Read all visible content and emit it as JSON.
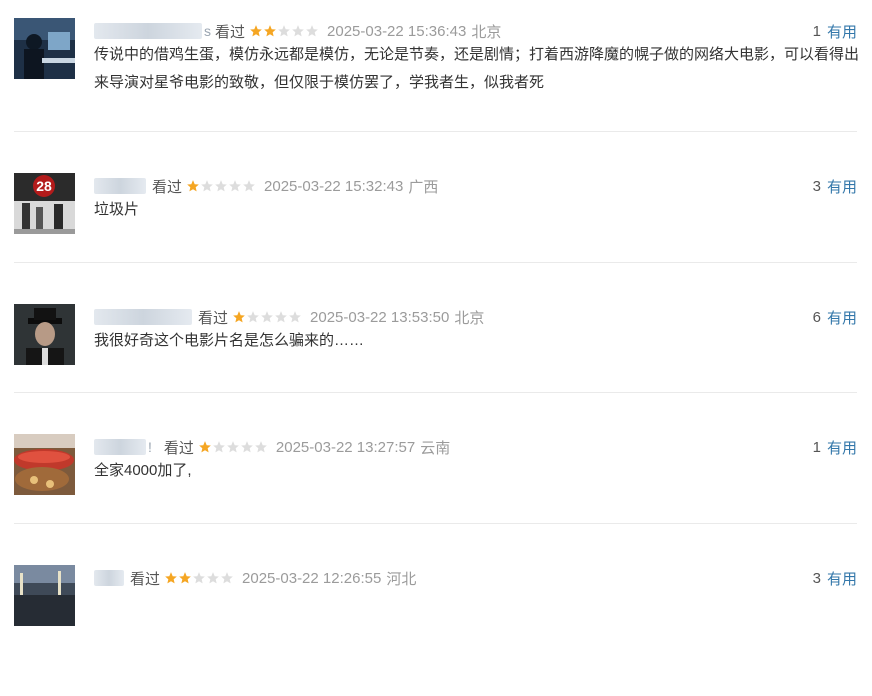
{
  "comments": [
    {
      "username_tail": "s",
      "watched": "看过",
      "rating": 2,
      "time": "2025-03-22 15:36:43",
      "location": "北京",
      "votes": "1",
      "useful": "有用",
      "text": "传说中的借鸡生蛋，模仿永远都是模仿，无论是节奏，还是剧情；打着西游降魔的幌子做的网络大电影，可以看得出来导演对星爷电影的致敬，但仅限于模仿罢了，学我者生，似我者死"
    },
    {
      "username_tail": "",
      "watched": "看过",
      "rating": 1,
      "time": "2025-03-22 15:32:43",
      "location": "广西",
      "votes": "3",
      "useful": "有用",
      "text": "垃圾片"
    },
    {
      "username_tail": "",
      "watched": "看过",
      "rating": 1,
      "time": "2025-03-22 13:53:50",
      "location": "北京",
      "votes": "6",
      "useful": "有用",
      "text": "我很好奇这个电影片名是怎么骗来的……"
    },
    {
      "username_tail": "!",
      "watched": "看过",
      "rating": 1,
      "time": "2025-03-22 13:27:57",
      "location": "云南",
      "votes": "1",
      "useful": "有用",
      "text": "全家4000加了,"
    },
    {
      "username_tail": "",
      "watched": "看过",
      "rating": 2,
      "time": "2025-03-22 12:26:55",
      "location": "河北",
      "votes": "3",
      "useful": "有用",
      "text": ""
    }
  ],
  "colors": {
    "star_filled": "#f5a623",
    "star_empty": "#dddddd",
    "useful_link": "#3377aa",
    "meta_gray": "#9b9b9b"
  },
  "avatars": [
    "person-at-computer-avatar",
    "movie-poster-28-avatar",
    "man-in-hat-avatar",
    "sausages-food-avatar",
    "night-street-avatar"
  ]
}
